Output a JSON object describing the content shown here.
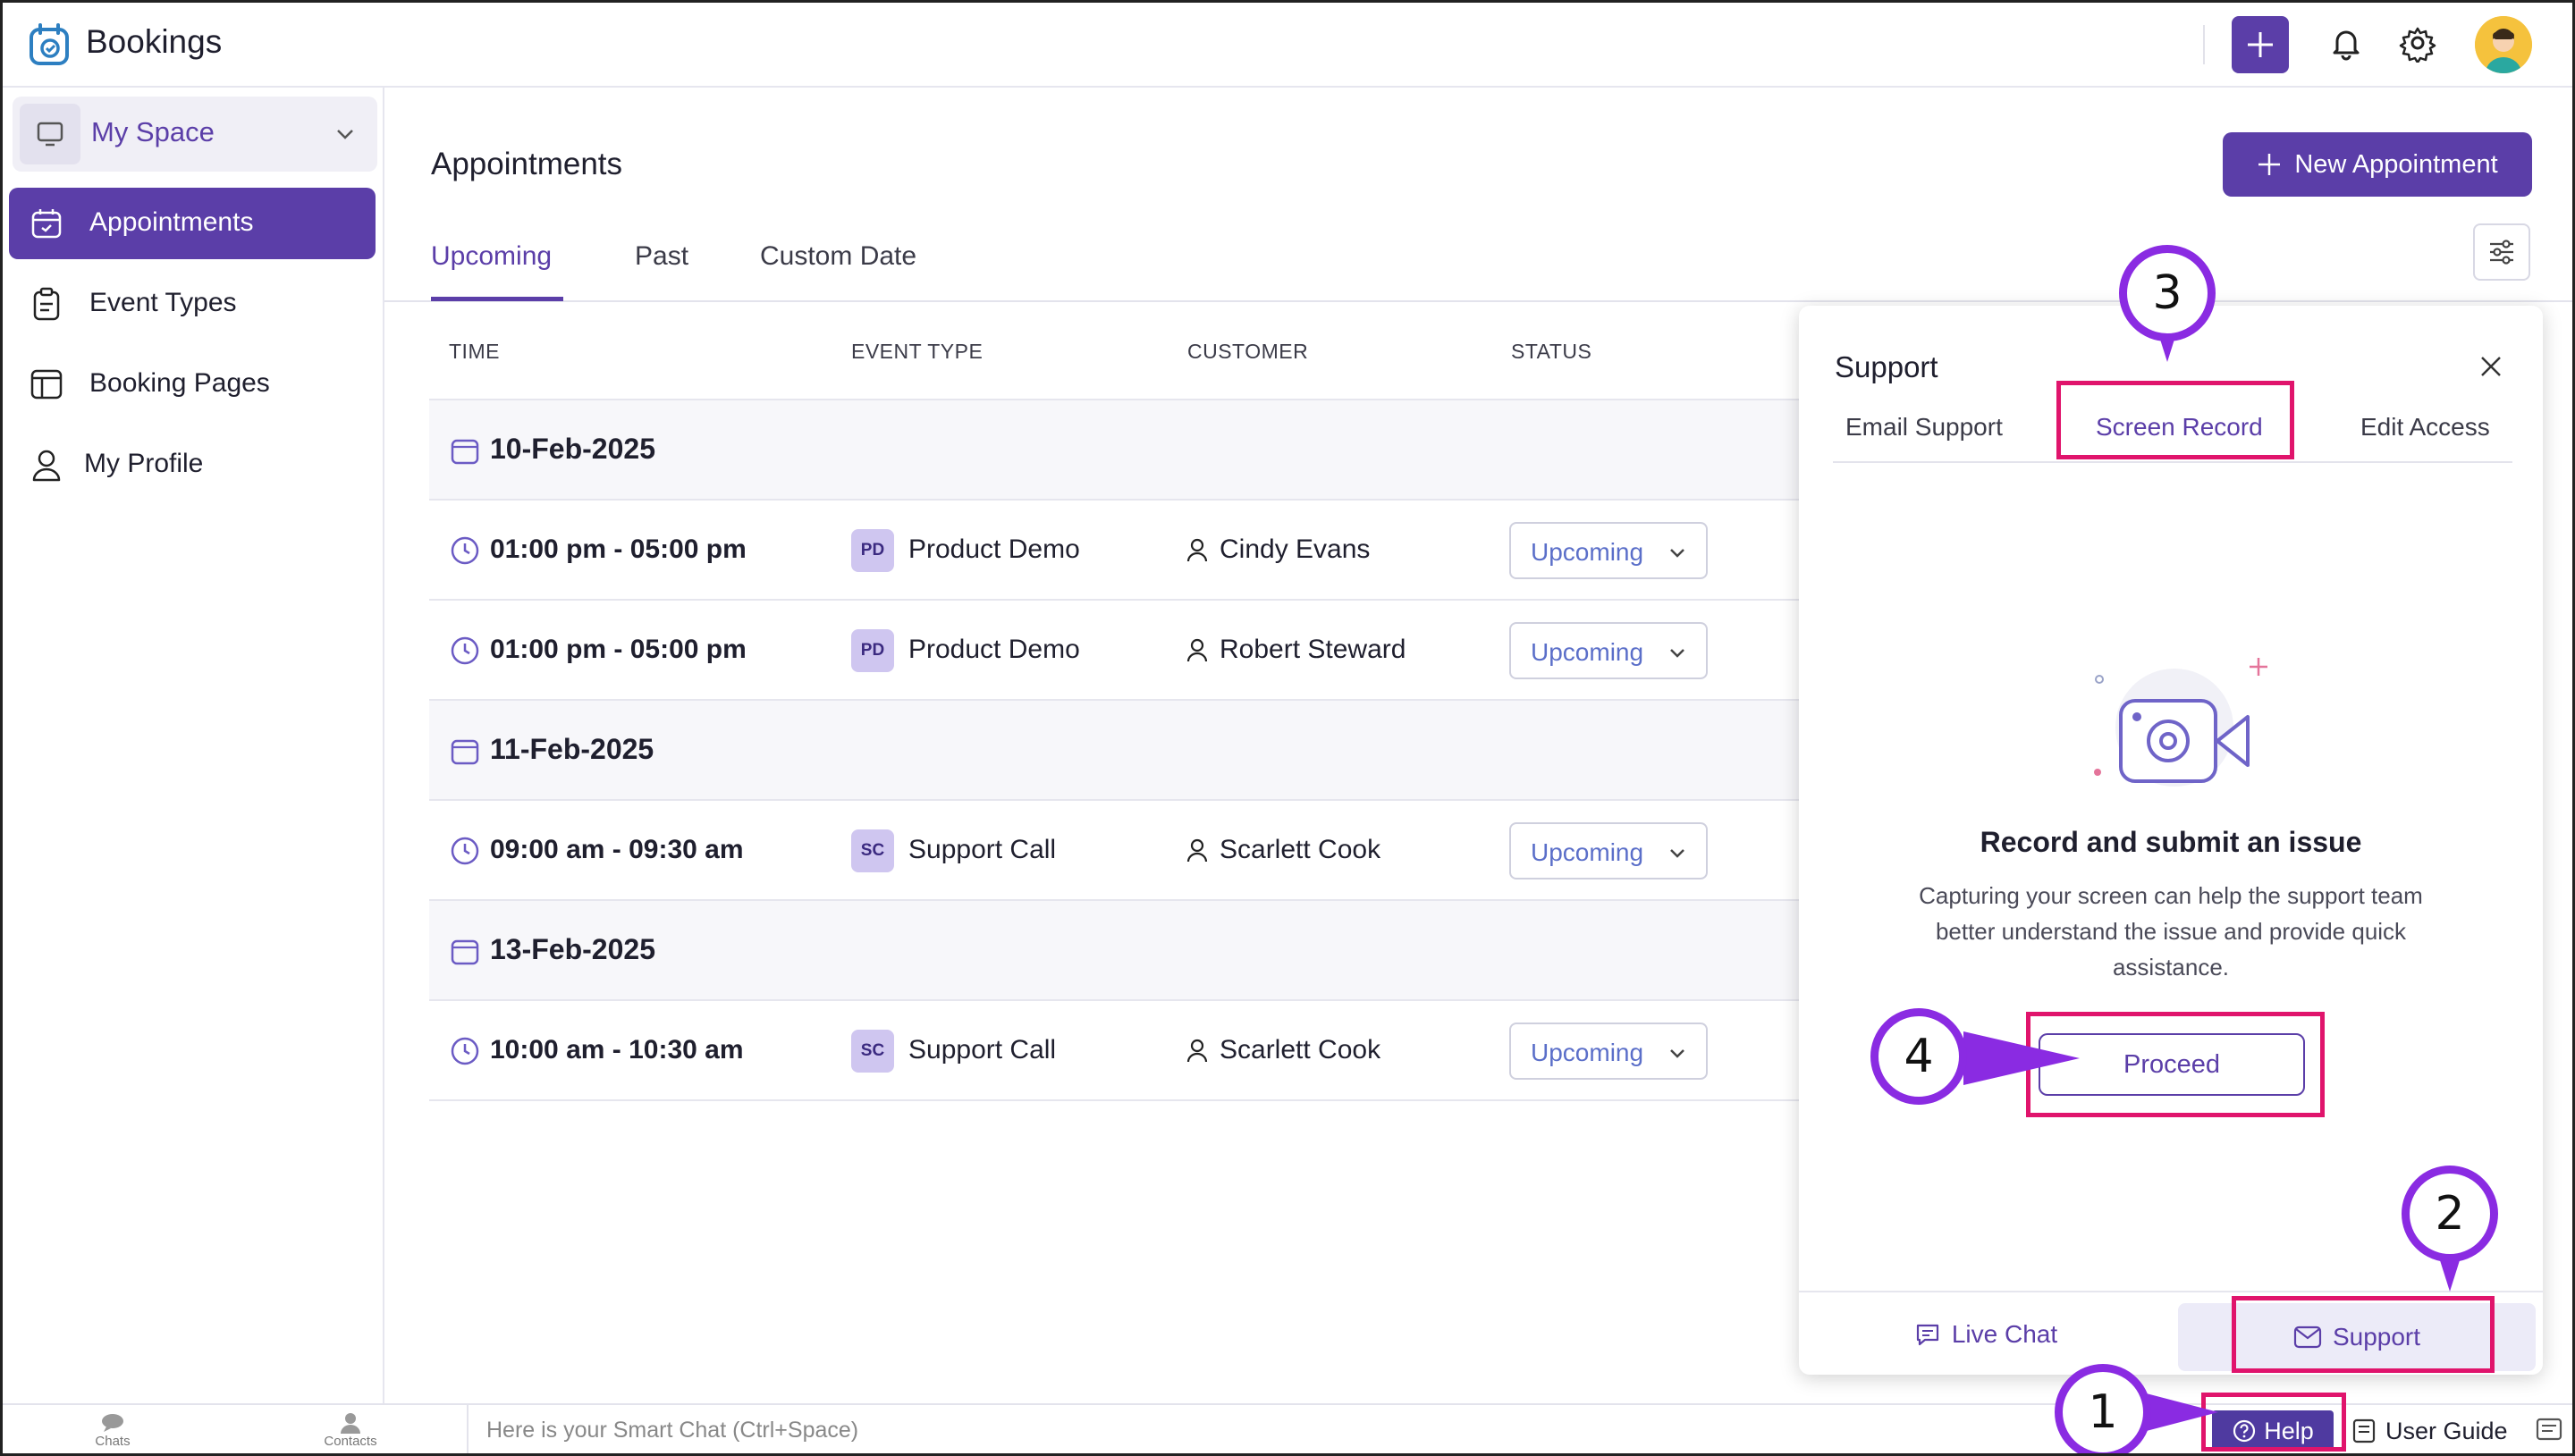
{
  "app": {
    "title": "Bookings"
  },
  "sidebar": {
    "space_label": "My Space",
    "items": [
      {
        "label": "Appointments",
        "active": true,
        "icon": "calendar-check-icon"
      },
      {
        "label": "Event Types",
        "icon": "clipboard-icon"
      },
      {
        "label": "Booking Pages",
        "icon": "layout-icon"
      },
      {
        "label": "My Profile",
        "icon": "user-icon"
      }
    ]
  },
  "main": {
    "title": "Appointments",
    "new_button": "New Appointment",
    "tabs": [
      "Upcoming",
      "Past",
      "Custom Date"
    ],
    "active_tab": "Upcoming",
    "columns": [
      "TIME",
      "EVENT TYPE",
      "CUSTOMER",
      "STATUS"
    ],
    "groups": [
      {
        "date": "10-Feb-2025",
        "rows": [
          {
            "time": "01:00 pm - 05:00 pm",
            "badge": "PD",
            "event": "Product Demo",
            "customer": "Cindy Evans",
            "status": "Upcoming"
          },
          {
            "time": "01:00 pm - 05:00 pm",
            "badge": "PD",
            "event": "Product Demo",
            "customer": "Robert Steward",
            "status": "Upcoming"
          }
        ]
      },
      {
        "date": "11-Feb-2025",
        "rows": [
          {
            "time": "09:00 am - 09:30 am",
            "badge": "SC",
            "event": "Support Call",
            "customer": "Scarlett Cook",
            "status": "Upcoming"
          }
        ]
      },
      {
        "date": "13-Feb-2025",
        "rows": [
          {
            "time": "10:00 am - 10:30 am",
            "badge": "SC",
            "event": "Support Call",
            "customer": "Scarlett Cook",
            "status": "Upcoming"
          }
        ]
      }
    ]
  },
  "support_panel": {
    "title": "Support",
    "tabs": [
      "Email Support",
      "Screen Record",
      "Edit Access"
    ],
    "active_tab": "Screen Record",
    "heading": "Record and submit an issue",
    "description": "Capturing your screen can help the support team better understand the issue and provide quick assistance.",
    "proceed_label": "Proceed",
    "footer": {
      "live_chat": "Live Chat",
      "support": "Support"
    }
  },
  "bottombar": {
    "chats": "Chats",
    "contacts": "Contacts",
    "smart_chat_placeholder": "Here is your Smart Chat (Ctrl+Space)",
    "help": "Help",
    "user_guide": "User Guide"
  },
  "annotations": [
    "1",
    "2",
    "3",
    "4"
  ],
  "colors": {
    "accent": "#5b3ea8",
    "highlight": "#e0146c",
    "callout": "#8a2be2"
  }
}
